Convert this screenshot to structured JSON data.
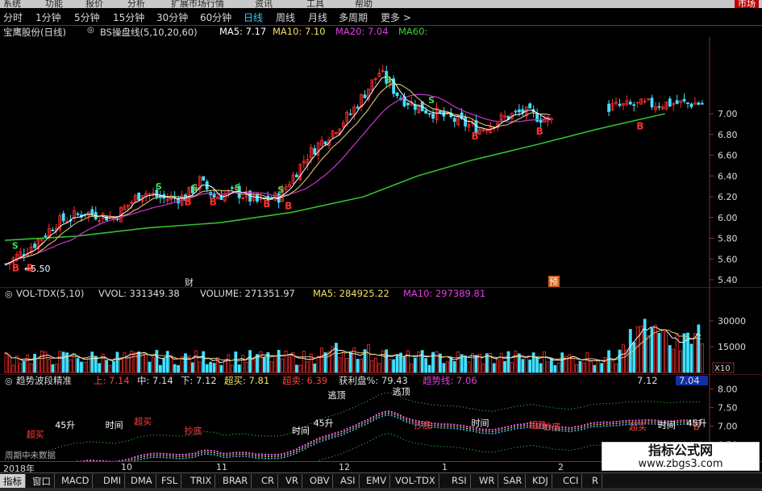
{
  "menu": {
    "items": [
      "系统",
      "功能",
      "报价",
      "分析",
      "扩展市场行情",
      "资讯",
      "工具",
      "帮助"
    ],
    "right_label": "市场"
  },
  "toolbar": {
    "periods": [
      "分时",
      "1分钟",
      "5分钟",
      "15分钟",
      "30分钟",
      "60分钟",
      "日线",
      "周线",
      "月线",
      "多周期",
      "更多 >"
    ],
    "active": "日线"
  },
  "main_header": {
    "stock": "宝鹰股份(日线)",
    "indicator": "BS操盘线(5,10,20,60)",
    "ma5": "MA5: 7.17",
    "ma10": "MA10: 7.10",
    "ma20": "MA20: 7.04",
    "ma60": "MA60:"
  },
  "main_chart": {
    "y_ticks": [
      "7.00",
      "6.80",
      "6.60",
      "6.40",
      "6.20",
      "6.00",
      "5.80",
      "5.60",
      "5.40"
    ],
    "low_label": "5.50",
    "markers": [
      "财",
      "预"
    ],
    "signal_b": "B",
    "signal_s": "S",
    "colors": {
      "up": "#ff3030",
      "down": "#40e0ff",
      "ma5": "#ffffff",
      "ma10": "#e8d080",
      "ma20": "#d040d0",
      "ma60": "#40c040"
    }
  },
  "volume_header": {
    "name": "VOL-TDX(5,10)",
    "vvol": "VVOL: 331349.38",
    "volume": "VOLUME: 271351.97",
    "ma5": "MA5: 284925.22",
    "ma10": "MA10: 297389.81"
  },
  "volume_chart": {
    "y_ticks": [
      "30000",
      "15000"
    ],
    "unit": "X10"
  },
  "indicator_header": {
    "name": "趋势波段精准",
    "up": "上: 7.14",
    "mid": "中: 7.14",
    "down": "下: 7.12",
    "overbuy": "超买: 7.81",
    "oversell": "超卖: 6.39",
    "profit": "获利盘%: 79.43",
    "trend": "趋势线: 7.06",
    "right_val1": "7.12",
    "right_val2": "7.04"
  },
  "indicator_chart": {
    "y_ticks": [
      "8.00",
      "7.50",
      "7.00",
      "6.50"
    ],
    "labels": [
      "逃顶",
      "逃顶",
      "45升",
      "45升",
      "45升",
      "时间",
      "时间",
      "时间",
      "时间",
      "超买",
      "超买",
      "超跌",
      "抄底",
      "抄底",
      "抄底",
      "超买",
      "B"
    ],
    "bottom_note": "周期中未数据"
  },
  "x_axis": {
    "labels": [
      "2018年",
      "10",
      "11",
      "12",
      "1",
      "2"
    ]
  },
  "tabs": {
    "items": [
      "指标",
      "窗口",
      "MACD",
      "DMI",
      "DMA",
      "FSL",
      "TRIX",
      "BRAR",
      "CR",
      "VR",
      "OBV",
      "ASI",
      "EMV",
      "VOL-TDX",
      "RSI",
      "WR",
      "SAR",
      "KDJ",
      "CCI",
      "R"
    ],
    "active": "指标"
  },
  "watermark": {
    "line1": "指标公式网",
    "line2": "www.zbgs3.com"
  }
}
